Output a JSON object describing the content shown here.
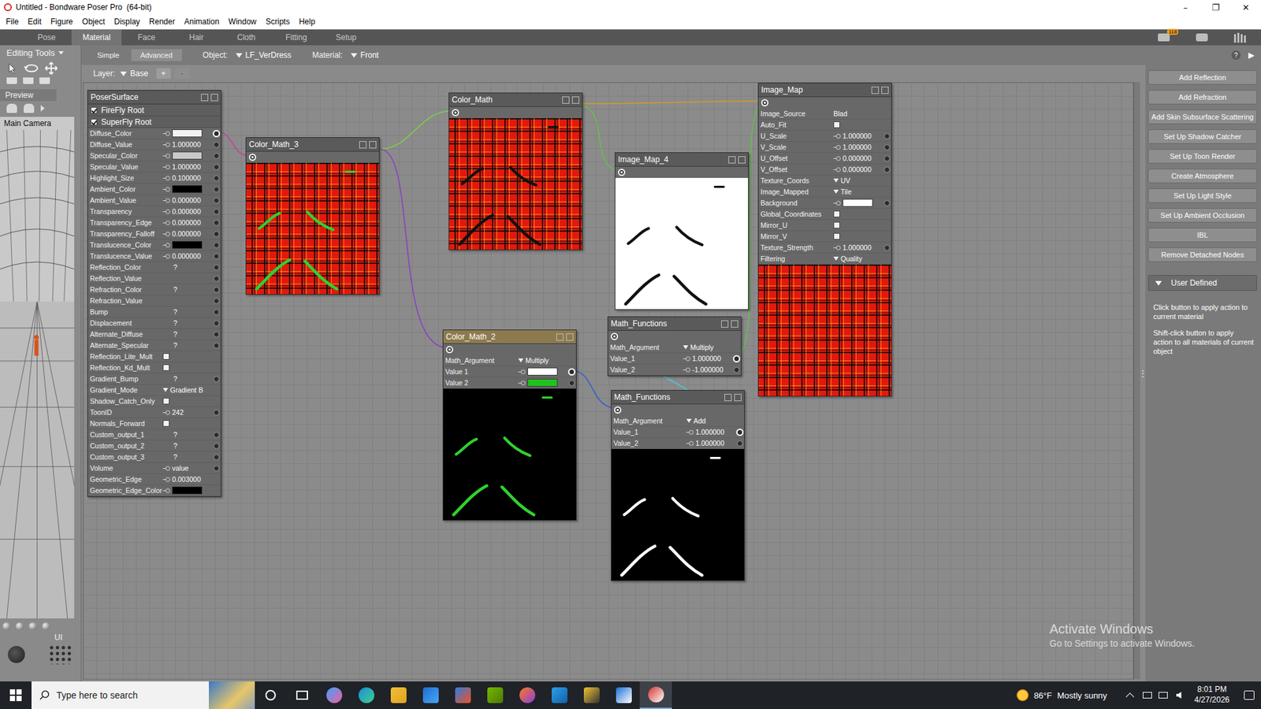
{
  "window": {
    "title": "Untitled - Bondware Poser Pro  (64-bit)",
    "controls": [
      "–",
      "❐",
      "✕"
    ]
  },
  "menu": [
    "File",
    "Edit",
    "Figure",
    "Object",
    "Display",
    "Render",
    "Animation",
    "Window",
    "Scripts",
    "Help"
  ],
  "rooms": [
    {
      "label": "Pose",
      "selected": false
    },
    {
      "label": "Material",
      "selected": true
    },
    {
      "label": "Face",
      "selected": false
    },
    {
      "label": "Hair",
      "selected": false
    },
    {
      "label": "Cloth",
      "selected": false
    },
    {
      "label": "Fitting",
      "selected": false
    },
    {
      "label": "Setup",
      "selected": false
    }
  ],
  "room_badge": "118",
  "subtabs": [
    {
      "label": "Simple",
      "selected": false
    },
    {
      "label": "Advanced",
      "selected": true
    }
  ],
  "object": {
    "label": "Object:",
    "value": "LF_VerDress"
  },
  "material": {
    "label": "Material:",
    "value": "Front"
  },
  "help": "?",
  "expand": "▶",
  "layer": {
    "label": "Layer:",
    "value": "Base",
    "add": "+",
    "remove": "-"
  },
  "left": {
    "title": "Editing Tools",
    "preview_tab": "Preview",
    "camera": "Main Camera",
    "ui_label": "UI"
  },
  "nodes": [
    {
      "title": "PoserSurface",
      "selected": false,
      "output": false,
      "preview": null,
      "rows": [
        {
          "label": "FireFly Root",
          "kind": "root",
          "checked": true
        },
        {
          "label": "SuperFly Root",
          "kind": "root",
          "checked": true
        },
        {
          "label": "Diffuse_Color",
          "kind": "color",
          "color": "#f2f2f2",
          "socket": true,
          "linked": true
        },
        {
          "label": "Diffuse_Value",
          "kind": "number",
          "value": "1.000000",
          "socket": true,
          "linked": false
        },
        {
          "label": "Specular_Color",
          "kind": "color",
          "color": "#c8c8c8",
          "socket": true,
          "linked": false
        },
        {
          "label": "Specular_Value",
          "kind": "number",
          "value": "1.000000",
          "socket": true,
          "linked": false
        },
        {
          "label": "Highlight_Size",
          "kind": "number",
          "value": "0.100000",
          "socket": true,
          "linked": false
        },
        {
          "label": "Ambient_Color",
          "kind": "color",
          "color": "#000000",
          "socket": true,
          "linked": false
        },
        {
          "label": "Ambient_Value",
          "kind": "number",
          "value": "0.000000",
          "socket": true,
          "linked": false
        },
        {
          "label": "Transparency",
          "kind": "number",
          "value": "0.000000",
          "socket": true,
          "linked": false
        },
        {
          "label": "Transparency_Edge",
          "kind": "number",
          "value": "0.000000",
          "socket": true,
          "linked": false
        },
        {
          "label": "Transparency_Falloff",
          "kind": "number",
          "value": "0.000000",
          "socket": true,
          "linked": false
        },
        {
          "label": "Translucence_Color",
          "kind": "color",
          "color": "#000000",
          "socket": true,
          "linked": false
        },
        {
          "label": "Translucence_Value",
          "kind": "number",
          "value": "0.000000",
          "socket": true,
          "linked": false
        },
        {
          "label": "Reflection_Color",
          "kind": "empty",
          "value": "?",
          "socket": true,
          "linked": false
        },
        {
          "label": "Reflection_Value",
          "kind": "empty",
          "socket": true,
          "linked": false
        },
        {
          "label": "Refraction_Color",
          "kind": "empty",
          "value": "?",
          "socket": true,
          "linked": false
        },
        {
          "label": "Refraction_Value",
          "kind": "empty",
          "socket": true,
          "linked": false
        },
        {
          "label": "Bump",
          "kind": "empty",
          "value": "?",
          "socket": true,
          "linked": false
        },
        {
          "label": "Displacement",
          "kind": "empty",
          "value": "?",
          "socket": true,
          "linked": false
        },
        {
          "label": "Alternate_Diffuse",
          "kind": "empty",
          "value": "?",
          "socket": true,
          "linked": false
        },
        {
          "label": "Alternate_Specular",
          "kind": "empty",
          "value": "?",
          "socket": true,
          "linked": false
        },
        {
          "label": "Reflection_Lite_Mult",
          "kind": "check",
          "checked": false,
          "socket": false,
          "linked": false
        },
        {
          "label": "Reflection_Kd_Mult",
          "kind": "check",
          "checked": false,
          "socket": false,
          "linked": false
        },
        {
          "label": "Gradient_Bump",
          "kind": "empty",
          "value": "?",
          "socket": true,
          "linked": false
        },
        {
          "label": "Gradient_Mode",
          "kind": "dropdown",
          "value": "Gradient B",
          "socket": false,
          "linked": false
        },
        {
          "label": "Shadow_Catch_Only",
          "kind": "check",
          "checked": false,
          "socket": false,
          "linked": false
        },
        {
          "label": "ToonID",
          "kind": "number",
          "value": "242",
          "socket": true,
          "linked": false
        },
        {
          "label": "Normals_Forward",
          "kind": "check",
          "checked": false,
          "socket": false,
          "linked": false
        },
        {
          "label": "Custom_output_1",
          "kind": "empty",
          "value": "?",
          "socket": true,
          "linked": false
        },
        {
          "label": "Custom_output_2",
          "kind": "empty",
          "value": "?",
          "socket": true,
          "linked": false
        },
        {
          "label": "Custom_output_3",
          "kind": "empty",
          "value": "?",
          "socket": true,
          "linked": false
        },
        {
          "label": "Volume",
          "kind": "number",
          "value": "value",
          "socket": true,
          "linked": false
        },
        {
          "label": "Geometric_Edge",
          "kind": "number",
          "value": "0.003000",
          "socket": false,
          "linked": false
        },
        {
          "label": "Geometric_Edge_Color",
          "kind": "color",
          "color": "#000000",
          "socket": false,
          "linked": false
        }
      ]
    },
    {
      "title": "Color_Math_3",
      "selected": false,
      "output": true,
      "preview": {
        "ground": "plaid",
        "marks": "#2fd12f"
      },
      "rows": []
    },
    {
      "title": "Color_Math",
      "selected": false,
      "output": true,
      "preview": {
        "ground": "plaid",
        "marks": "#111111"
      },
      "rows": []
    },
    {
      "title": "Image_Map_4",
      "selected": false,
      "output": true,
      "preview": {
        "ground": "white",
        "marks": "#111111"
      },
      "rows": []
    },
    {
      "title": "Image_Map",
      "selected": false,
      "output": true,
      "preview": {
        "ground": "plaid",
        "marks": null
      },
      "rows": [
        {
          "label": "Image_Source",
          "kind": "text",
          "value": "Blad",
          "socket": false,
          "linked": false
        },
        {
          "label": "Auto_Fit",
          "kind": "check",
          "checked": false,
          "socket": false,
          "linked": false
        },
        {
          "label": "U_Scale",
          "kind": "number",
          "value": "1.000000",
          "socket": true,
          "linked": false
        },
        {
          "label": "V_Scale",
          "kind": "number",
          "value": "1.000000",
          "socket": true,
          "linked": false
        },
        {
          "label": "U_Offset",
          "kind": "number",
          "value": "0.000000",
          "socket": true,
          "linked": false
        },
        {
          "label": "V_Offset",
          "kind": "number",
          "value": "0.000000",
          "socket": true,
          "linked": false
        },
        {
          "label": "Texture_Coords",
          "kind": "dropdown",
          "value": "UV",
          "socket": false,
          "linked": false
        },
        {
          "label": "Image_Mapped",
          "kind": "dropdown",
          "value": "Tile",
          "socket": false,
          "linked": false
        },
        {
          "label": "Background",
          "kind": "color",
          "color": "#ffffff",
          "socket": true,
          "linked": false
        },
        {
          "label": "Global_Coordinates",
          "kind": "check",
          "checked": false,
          "socket": false,
          "linked": false
        },
        {
          "label": "Mirror_U",
          "kind": "check",
          "checked": false,
          "socket": false,
          "linked": false
        },
        {
          "label": "Mirror_V",
          "kind": "check",
          "checked": false,
          "socket": false,
          "linked": false
        },
        {
          "label": "Texture_Strength",
          "kind": "number",
          "value": "1.000000",
          "socket": true,
          "linked": false
        },
        {
          "label": "Filtering",
          "kind": "dropdown",
          "value": "Quality",
          "socket": false,
          "linked": false
        }
      ]
    },
    {
      "title": "Color_Math_2",
      "selected": true,
      "output": true,
      "preview": {
        "ground": "black",
        "marks": "#2fd12f"
      },
      "rows": [
        {
          "label": "Math_Argument",
          "kind": "dropdown",
          "value": "Multiply",
          "socket": false,
          "linked": false
        },
        {
          "label": "Value 1",
          "kind": "color",
          "color": "#ffffff",
          "socket": true,
          "linked": true
        },
        {
          "label": "Value 2",
          "kind": "color",
          "color": "#1fc21f",
          "socket": true,
          "linked": false
        }
      ]
    },
    {
      "title": "Math_Functions",
      "selected": false,
      "output": true,
      "preview": null,
      "rows": [
        {
          "label": "Math_Argument",
          "kind": "dropdown",
          "value": "Multiply",
          "socket": false,
          "linked": false
        },
        {
          "label": "Value_1",
          "kind": "number",
          "value": "1.000000",
          "socket": true,
          "linked": true
        },
        {
          "label": "Value_2",
          "kind": "number",
          "value": "-1.000000",
          "socket": true,
          "linked": false
        }
      ]
    },
    {
      "title": "Math_Functions",
      "selected": false,
      "output": true,
      "preview": {
        "ground": "black",
        "marks": "#ffffff"
      },
      "rows": [
        {
          "label": "Math_Argument",
          "kind": "dropdown",
          "value": "Add",
          "socket": false,
          "linked": false
        },
        {
          "label": "Value_1",
          "kind": "number",
          "value": "1.000000",
          "socket": true,
          "linked": true
        },
        {
          "label": "Value_2",
          "kind": "number",
          "value": "1.000000",
          "socket": true,
          "linked": false
        }
      ]
    }
  ],
  "grip": "⋮",
  "actions": [
    "Add Reflection",
    "Add Refraction",
    "Add Skin Subsurface Scattering",
    "Set Up Shadow Catcher",
    "Set Up Toon Render",
    "Create Atmosphere",
    "Set Up Light Style",
    "Set Up Ambient Occlusion",
    "IBL",
    "Remove Detached Nodes"
  ],
  "user_defined": "User Defined",
  "hints": [
    "Click button to apply action to current material",
    "Shift-click button to apply action to all materials of current object"
  ],
  "watermark": {
    "title": "Activate Windows",
    "subtitle": "Go to Settings to activate Windows."
  },
  "taskbar": {
    "search": "Type here to search",
    "weather": "86°F",
    "weather_text": "Mostly sunny",
    "time": "8:01 PM",
    "date": "4/27/2026",
    "apps": [
      {
        "selected": false
      },
      {
        "selected": false
      },
      {
        "selected": false
      },
      {
        "selected": false
      },
      {
        "selected": false
      },
      {
        "selected": false
      },
      {
        "selected": false
      },
      {
        "selected": false
      },
      {
        "selected": false
      },
      {
        "selected": false
      },
      {
        "selected": true
      }
    ]
  }
}
